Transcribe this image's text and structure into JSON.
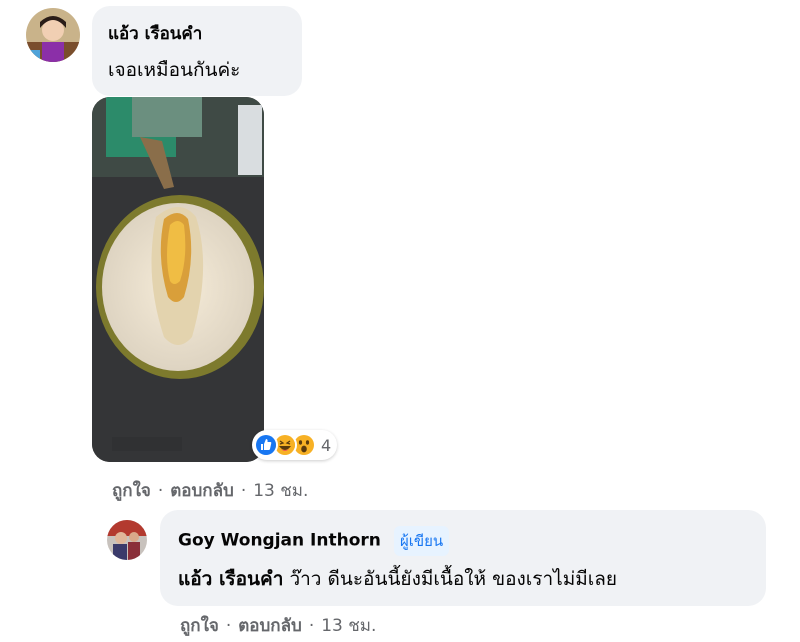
{
  "comment1": {
    "author": "แอ้ว เรือนคำ",
    "text": "เจอเหมือนกันค่ะ",
    "reactions": {
      "icons": [
        "like-icon",
        "haha-icon",
        "wow-icon"
      ],
      "count": "4"
    },
    "actions": {
      "like": "ถูกใจ",
      "reply": "ตอบกลับ",
      "time": "13 ชม."
    }
  },
  "reply1": {
    "author": "Goy Wongjan Inthorn",
    "badge": "ผู้เขียน",
    "mention": "แอ้ว เรือนคำ",
    "text": "ว๊าว ดีนะอันนี้ยังมีเนื้อให้ ของเราไม่มีเลย",
    "actions": {
      "like": "ถูกใจ",
      "reply": "ตอบกลับ",
      "time": "13 ชม."
    }
  },
  "separator": "·",
  "colors": {
    "bubble": "#f0f2f5",
    "meta": "#65676b",
    "badge_bg": "#e7f3ff",
    "badge_text": "#1877f2"
  }
}
